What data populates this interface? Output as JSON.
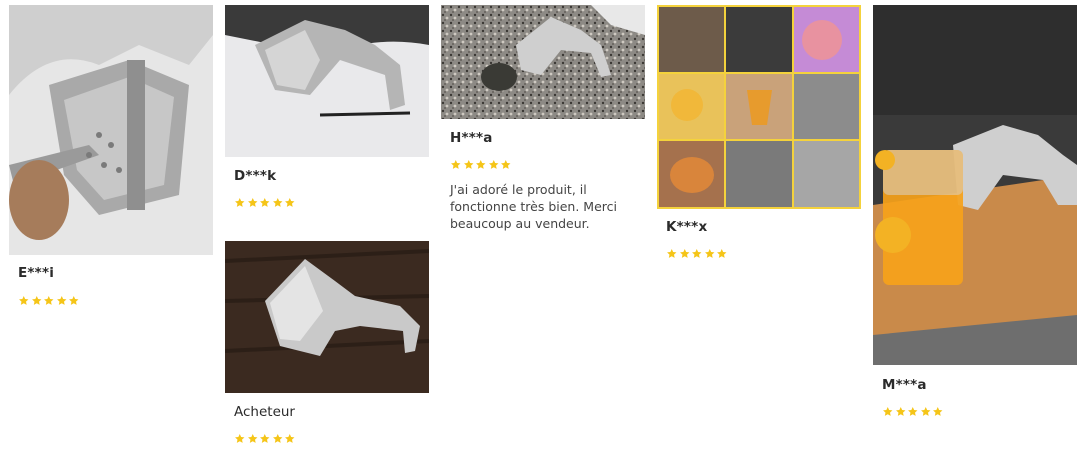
{
  "reviews": [
    {
      "author": "E***i",
      "rating": 5
    },
    {
      "author": "D***k",
      "rating": 5
    },
    {
      "author": "Acheteur",
      "rating": 5
    },
    {
      "author": "H***a",
      "rating": 5,
      "text": "J'ai adoré le produit, il fonctionne très bien. Merci beaucoup au vendeur."
    },
    {
      "author": "K***x",
      "rating": 5
    },
    {
      "author": "M***a",
      "rating": 5
    }
  ],
  "colors": {
    "star": "#f5c518",
    "text": "#2b2b2b"
  },
  "icons": {
    "star": "star-icon"
  }
}
